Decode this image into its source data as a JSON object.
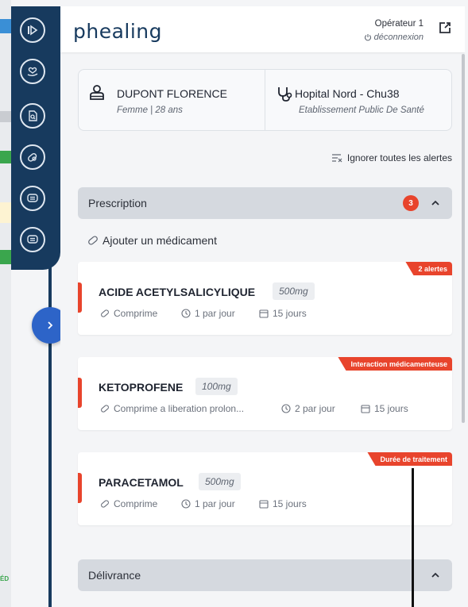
{
  "header": {
    "logo": "phealing",
    "operator": "Opérateur 1",
    "logout": "déconnexion"
  },
  "patient": {
    "name": "DUPONT FLORENCE",
    "details": "Femme | 28 ans",
    "hospital": "Hopital Nord - Chu38",
    "hospital_type": "Etablissement Public De Santé"
  },
  "actions": {
    "ignore_alerts": "Ignorer toutes les alertes",
    "add_medication": "Ajouter un médicament"
  },
  "sections": {
    "prescription": {
      "label": "Prescription",
      "badge": "3"
    },
    "delivery": {
      "label": "Délivrance"
    }
  },
  "medications": [
    {
      "name": "ACIDE ACETYLSALICYLIQUE",
      "dose": "500mg",
      "form": "Comprime",
      "frequency": "1 par jour",
      "duration": "15 jours",
      "alert": "2 alertes"
    },
    {
      "name": "KETOPROFENE",
      "dose": "100mg",
      "form": "Comprime a liberation prolon...",
      "frequency": "2 par jour",
      "duration": "15 jours",
      "alert": "Interaction médicamenteuse"
    },
    {
      "name": "PARACETAMOL",
      "dose": "500mg",
      "form": "Comprime",
      "frequency": "1 par jour",
      "duration": "15 jours",
      "alert": "Durée de traitement"
    }
  ],
  "colors": {
    "sidebar": "#173a5e",
    "accent_blue": "#2d64c8",
    "alert_red": "#e8442c",
    "section_bar": "#d5d9df"
  },
  "icons": {
    "sidebar": [
      "skip-icon",
      "heart-hand-icon",
      "document-search-icon",
      "pill-search-icon",
      "chat-icon",
      "message-icon"
    ],
    "expand": "chevron-right-icon"
  }
}
